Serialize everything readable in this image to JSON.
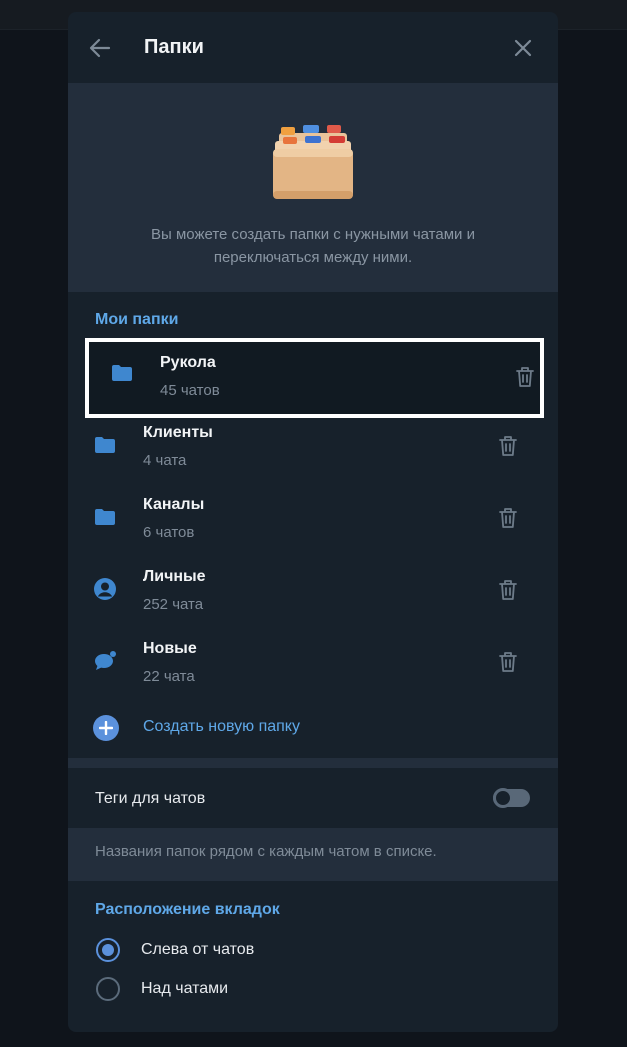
{
  "header": {
    "title": "Папки",
    "back_icon": "arrow-left-icon",
    "close_icon": "close-icon"
  },
  "hero": {
    "illustration": "file-cabinet-icon",
    "text": "Вы можете создать папки с нужными чатами и переключаться между ними."
  },
  "my_folders": {
    "title": "Мои папки",
    "items": [
      {
        "name": "Рукола",
        "count": "45 чатов",
        "icon": "folder-icon"
      },
      {
        "name": "Клиенты",
        "count": "4 чата",
        "icon": "folder-icon"
      },
      {
        "name": "Каналы",
        "count": "6 чатов",
        "icon": "folder-icon"
      },
      {
        "name": "Личные",
        "count": "252 чата",
        "icon": "user-circle-icon"
      },
      {
        "name": "Новые",
        "count": "22 чата",
        "icon": "chat-bubble-icon"
      }
    ],
    "create_label": "Создать новую папку"
  },
  "tags": {
    "label": "Теги для чатов",
    "enabled": false,
    "hint": "Названия папок рядом с каждым чатом в списке."
  },
  "tabs_position": {
    "title": "Расположение вкладок",
    "options": [
      {
        "label": "Слева от чатов",
        "checked": true
      },
      {
        "label": "Над чатами",
        "checked": false
      }
    ]
  },
  "colors": {
    "accent": "#5fa8e8",
    "panel": "#17212b",
    "band": "#232e3c",
    "icon": "#3f87cf"
  }
}
